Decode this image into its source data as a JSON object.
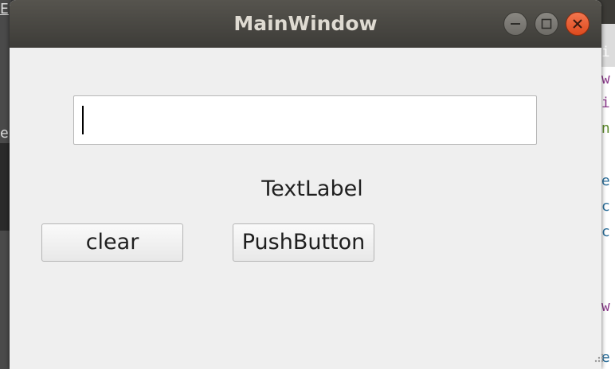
{
  "window": {
    "title": "MainWindow",
    "controls": {
      "minimize": "minimize-icon",
      "maximize": "maximize-icon",
      "close": "close-icon"
    },
    "colors": {
      "titlebar": "#3d3c38",
      "title_text": "#dfdbd2",
      "close_button": "#e3572b",
      "body": "#efefef"
    }
  },
  "form": {
    "line_edit": {
      "value": "",
      "placeholder": ""
    },
    "text_label": "TextLabel",
    "clear_button": "clear",
    "push_button": "PushButton"
  },
  "background": {
    "left_fragments": [
      "E",
      "e"
    ],
    "right_code": [
      {
        "text": "ai",
        "color": "#ffffff"
      },
      {
        "text": "ow",
        "color": "#8b3a8b"
      },
      {
        "text": "ai",
        "color": "#8b3a8b"
      },
      {
        "text": "(n",
        "color": "#5c8a2a"
      },
      {
        "text": "se",
        "color": "#2b6f9b"
      },
      {
        "text": "ec",
        "color": "#2b6f9b"
      },
      {
        "text": "ec",
        "color": "#2b6f9b"
      },
      {
        "text": "ow",
        "color": "#8b3a8b"
      },
      {
        "text": "te",
        "color": "#2b6f9b"
      }
    ]
  }
}
